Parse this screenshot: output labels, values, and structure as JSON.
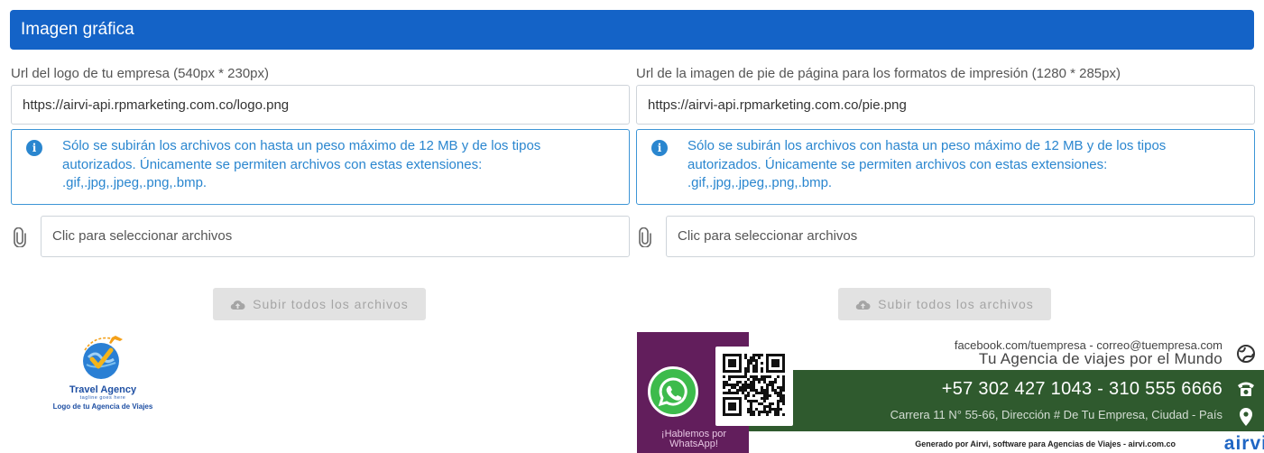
{
  "header": {
    "title": "Imagen gráfica"
  },
  "logo_section": {
    "label": "Url del logo de tu empresa (540px * 230px)",
    "url_value": "https://airvi-api.rpmarketing.com.co/logo.png",
    "info_text": "Sólo se subirán los archivos con hasta un peso máximo de 12 MB y de los tipos autorizados. Únicamente se permiten archivos con estas extensiones: .gif,.jpg,.jpeg,.png,.bmp.",
    "file_placeholder": "Clic para seleccionar archivos",
    "upload_label": "Subir todos los archivos",
    "preview": {
      "title": "Travel Agency",
      "tagline": "tagline goes here",
      "caption": "Logo de tu Agencia de Viajes"
    }
  },
  "footer_section": {
    "label": "Url de la imagen de pie de página para los formatos de impresión (1280 * 285px)",
    "url_value": "https://airvi-api.rpmarketing.com.co/pie.png",
    "info_text": "Sólo se subirán los archivos con hasta un peso máximo de 12 MB y de los tipos autorizados. Únicamente se permiten archivos con estas extensiones: .gif,.jpg,.jpeg,.png,.bmp.",
    "file_placeholder": "Clic para seleccionar archivos",
    "upload_label": "Subir todos los archivos",
    "preview": {
      "social": "facebook.com/tuempresa - correo@tuempresa.com",
      "slogan": "Tu Agencia de viajes por el Mundo",
      "phone": "+57 302 427 1043 - 310 555 6666",
      "address": "Carrera 11 N° 55-66, Dirección # De Tu Empresa, Ciudad - País",
      "whatsapp_line1": "¡Hablemos por",
      "whatsapp_line2": "WhatsApp!",
      "credit": "Generado por Airvi, software para Agencias de Viajes - airvi.com.co",
      "brand": "airvi"
    }
  },
  "colors": {
    "header_bg": "#1463c7",
    "info": "#2a86cf",
    "banner_purple": "#621e5c",
    "banner_green": "#2f5a2e",
    "whatsapp": "#3dbb4c"
  },
  "icons": [
    "info-icon",
    "paperclip-icon",
    "cloud-upload-icon",
    "whatsapp-icon",
    "qr-code-icon",
    "globe-icon",
    "phone-icon",
    "location-pin-icon"
  ]
}
